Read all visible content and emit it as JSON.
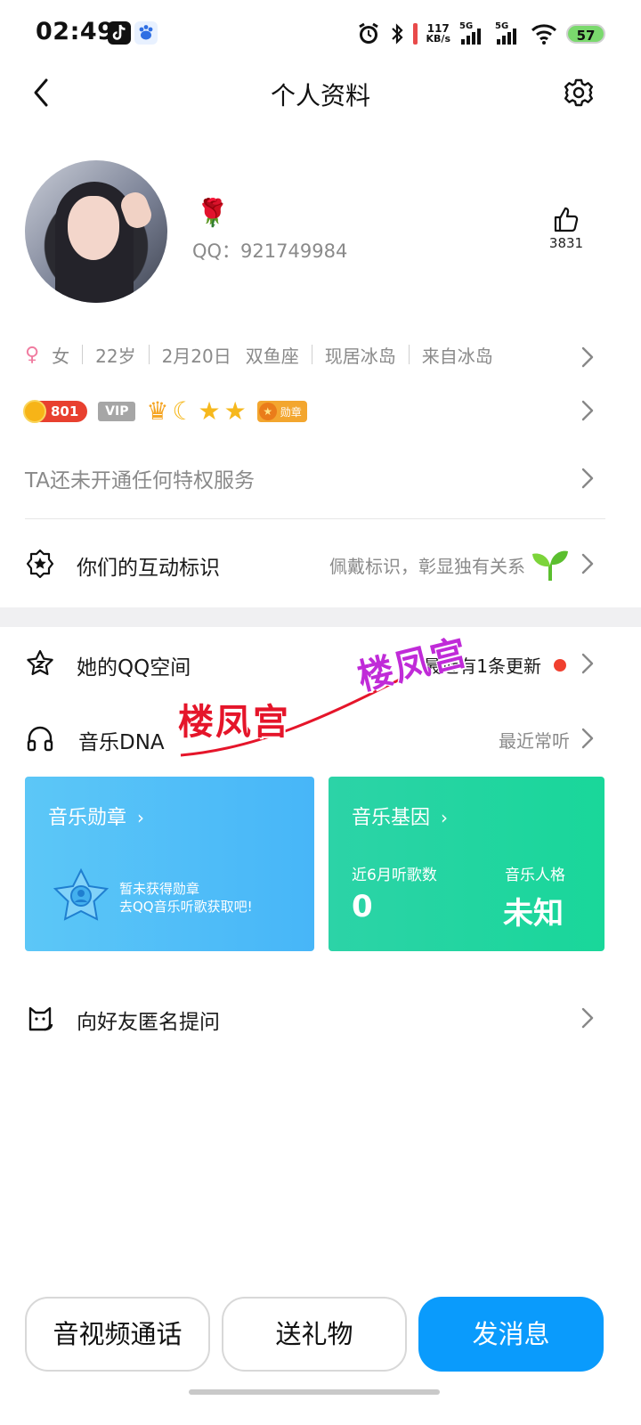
{
  "status_bar": {
    "time": "02:49",
    "net_speed_value": "117",
    "net_speed_unit": "KB/s",
    "signal1_label": "5G",
    "signal2_label": "5G",
    "battery": "57"
  },
  "header": {
    "title": "个人资料"
  },
  "profile": {
    "nickname_icon": "rose-emoji",
    "qq_label": "QQ：921749984",
    "like_count": "3831"
  },
  "info": {
    "gender": "女",
    "age": "22岁",
    "birthday": "2月20日",
    "zodiac": "双鱼座",
    "residence": "现居冰岛",
    "hometown": "来自冰岛"
  },
  "badges": {
    "level": "801",
    "vip": "VIP",
    "medal": "勋章"
  },
  "privilege_text": "TA还未开通任何特权服务",
  "interaction": {
    "label": "你们的互动标识",
    "hint": "佩戴标识，彰显独有关系"
  },
  "qzone": {
    "label": "她的QQ空间",
    "hint": "最近有1条更新"
  },
  "music_dna": {
    "label": "音乐DNA",
    "hint": "最近常听"
  },
  "music_medal_card": {
    "title": "音乐勋章",
    "note_line1": "暂未获得勋章",
    "note_line2": "去QQ音乐听歌获取吧!"
  },
  "music_gene_card": {
    "title": "音乐基因",
    "stat1_label": "近6月听歌数",
    "stat1_value": "0",
    "stat2_label": "音乐人格",
    "stat2_value": "未知"
  },
  "anonymous_question": {
    "label": "向好友匿名提问"
  },
  "watermark": {
    "text1": "楼凤宫",
    "text2": "楼凤宫"
  },
  "actions": {
    "call": "音视频通话",
    "gift": "送礼物",
    "message": "发消息"
  },
  "colors": {
    "primary": "#0a9bfc",
    "red_dot": "#f0402f",
    "card_blue": "#4fbdf8",
    "card_green": "#21d5a0"
  }
}
